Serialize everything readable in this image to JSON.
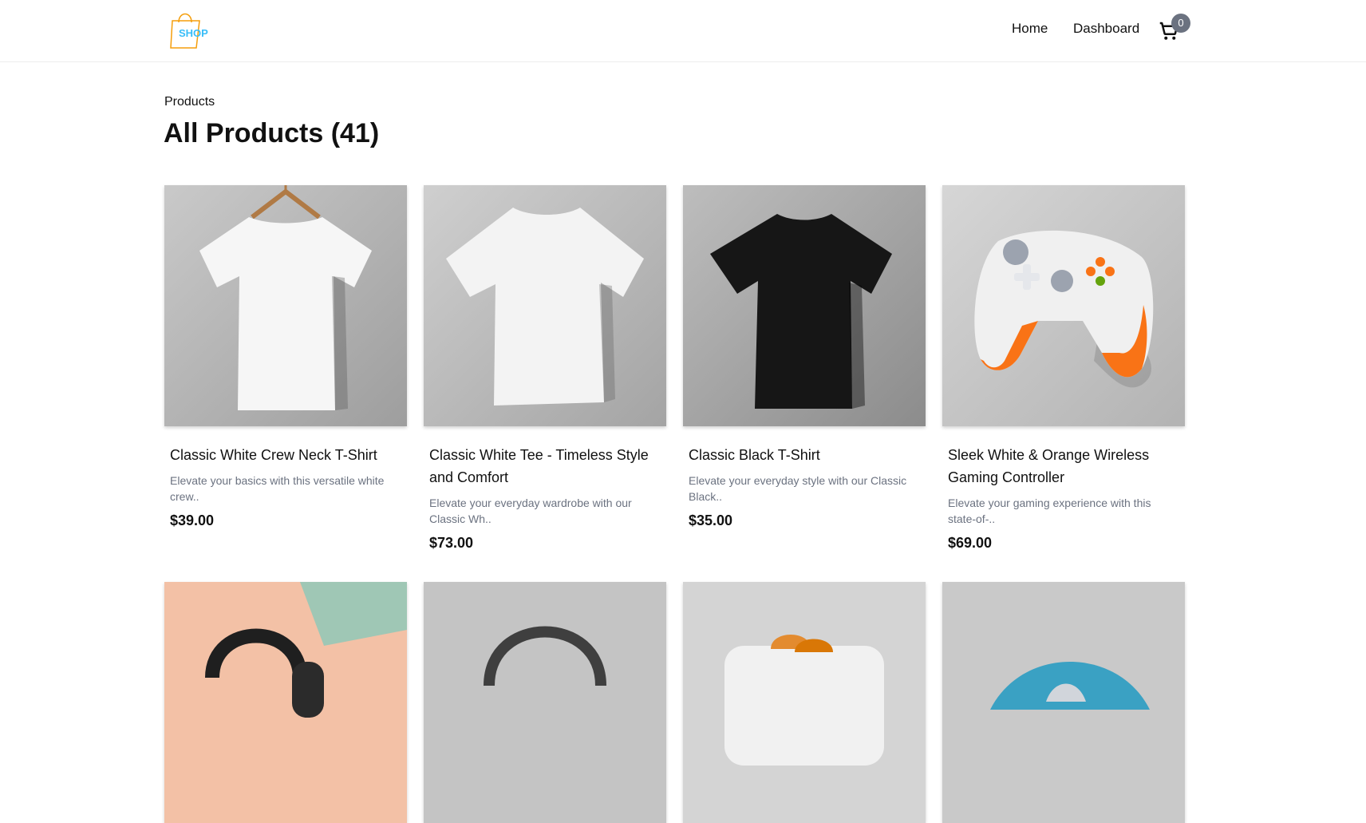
{
  "header": {
    "logo_text": "SHOP",
    "nav": [
      "Home",
      "Dashboard"
    ],
    "cart_count": "0"
  },
  "breadcrumb": "Products",
  "title": "All Products (41)",
  "products": [
    {
      "title": "Classic White Crew Neck T-Shirt",
      "desc": "Elevate your basics with this versatile white crew..",
      "price": "$39.00",
      "image": "white-tshirt-on-hanger"
    },
    {
      "title": "Classic White Tee - Timeless Style and Comfort",
      "desc": "Elevate your everyday wardrobe with our Classic Wh..",
      "price": "$73.00",
      "image": "white-tshirt"
    },
    {
      "title": "Classic Black T-Shirt",
      "desc": "Elevate your everyday style with our Classic Black..",
      "price": "$35.00",
      "image": "black-tshirt"
    },
    {
      "title": "Sleek White & Orange Wireless Gaming Controller",
      "desc": "Elevate your gaming experience with this state-of-..",
      "price": "$69.00",
      "image": "gaming-controller"
    },
    {
      "image": "headphones-on-peach"
    },
    {
      "image": "black-headphones"
    },
    {
      "image": "toaster"
    },
    {
      "image": "blue-mouse"
    }
  ],
  "colors": {
    "logo_orange": "#f59e0b",
    "logo_blue": "#38bdf8",
    "badge": "#6b7280",
    "muted_text": "#6b7280"
  }
}
